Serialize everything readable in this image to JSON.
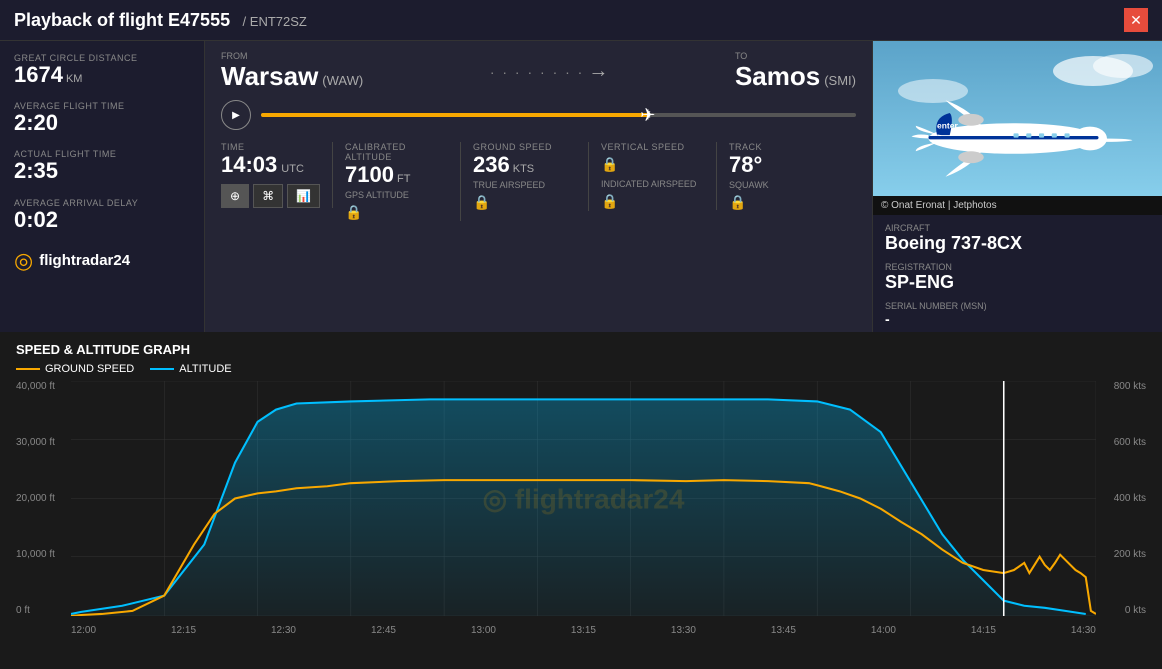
{
  "header": {
    "title": "Playback of flight E47555",
    "subtitle": "/ ENT72SZ",
    "close_label": "✕"
  },
  "stats": {
    "great_circle_label": "GREAT CIRCLE DISTANCE",
    "great_circle_value": "1674",
    "great_circle_unit": "KM",
    "avg_flight_label": "AVERAGE FLIGHT TIME",
    "avg_flight_value": "2:20",
    "actual_flight_label": "ACTUAL FLIGHT TIME",
    "actual_flight_value": "2:35",
    "avg_delay_label": "AVERAGE ARRIVAL DELAY",
    "avg_delay_value": "0:02"
  },
  "route": {
    "from_label": "FROM",
    "from_city": "Warsaw",
    "from_code": "(WAW)",
    "to_label": "TO",
    "to_city": "Samos",
    "to_code": "(SMI)"
  },
  "flight_data": {
    "time_label": "TIME",
    "time_value": "14:03",
    "time_unit": "UTC",
    "cal_alt_label": "CALIBRATED ALTITUDE",
    "cal_alt_value": "7100",
    "cal_alt_unit": "FT",
    "gps_alt_label": "GPS ALTITUDE",
    "ground_speed_label": "GROUND SPEED",
    "ground_speed_value": "236",
    "ground_speed_unit": "KTS",
    "true_airspeed_label": "TRUE AIRSPEED",
    "vertical_speed_label": "VERTICAL SPEED",
    "indicated_as_label": "INDICATED AIRSPEED",
    "track_label": "TRACK",
    "track_value": "78°",
    "squawk_label": "SQUAWK"
  },
  "aircraft": {
    "aircraft_label": "AIRCRAFT",
    "aircraft_value": "Boeing 737-8CX",
    "registration_label": "REGISTRATION",
    "registration_value": "SP-ENG",
    "serial_label": "SERIAL NUMBER (MSN)",
    "serial_value": "-",
    "photo_credit": "© Onat Eronat | Jetphotos"
  },
  "graph": {
    "title": "SPEED & ALTITUDE GRAPH",
    "legend_gs": "GROUND SPEED",
    "legend_alt": "ALTITUDE",
    "y_left_labels": [
      "40,000 ft",
      "30,000 ft",
      "20,000 ft",
      "10,000 ft",
      "0 ft"
    ],
    "y_right_labels": [
      "800 kts",
      "600 kts",
      "400 kts",
      "200 kts",
      "0 kts"
    ],
    "x_labels": [
      "12:00",
      "12:15",
      "12:30",
      "12:45",
      "13:00",
      "13:15",
      "13:30",
      "13:45",
      "14:00",
      "14:15",
      "14:30"
    ]
  },
  "logo": {
    "icon": "◎",
    "text": "flightradar24"
  },
  "watermark": "◎ flightradar24"
}
